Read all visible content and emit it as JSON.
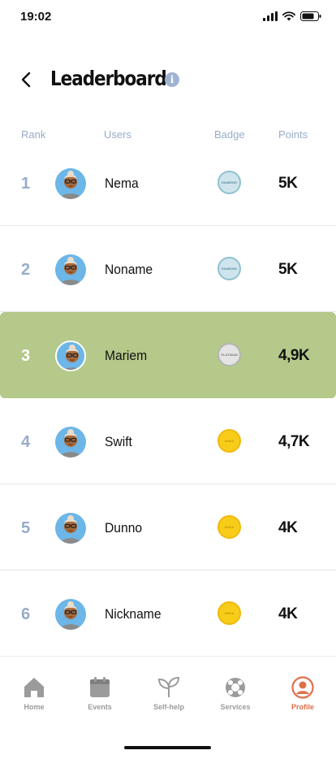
{
  "status_bar": {
    "time": "19:02"
  },
  "header": {
    "title": "Leaderboard"
  },
  "columns": {
    "rank": "Rank",
    "users": "Users",
    "badge": "Badge",
    "points": "Points"
  },
  "rows": [
    {
      "rank": "1",
      "name": "Nema",
      "badge": "diamond",
      "badge_text": "DIAMOND",
      "points": "5K",
      "highlighted": false
    },
    {
      "rank": "2",
      "name": "Noname",
      "badge": "diamond",
      "badge_text": "DIAMOND",
      "points": "5K",
      "highlighted": false
    },
    {
      "rank": "3",
      "name": "Mariem",
      "badge": "platinum",
      "badge_text": "PLATINUM",
      "points": "4,9K",
      "highlighted": true
    },
    {
      "rank": "4",
      "name": "Swift",
      "badge": "gold",
      "badge_text": "GOLD",
      "points": "4,7K",
      "highlighted": false
    },
    {
      "rank": "5",
      "name": "Dunno",
      "badge": "gold",
      "badge_text": "GOLD",
      "points": "4K",
      "highlighted": false
    },
    {
      "rank": "6",
      "name": "Nickname",
      "badge": "gold",
      "badge_text": "GOLD",
      "points": "4K",
      "highlighted": false
    }
  ],
  "nav": [
    {
      "label": "Home",
      "icon": "home-icon",
      "active": false
    },
    {
      "label": "Events",
      "icon": "calendar-icon",
      "active": false
    },
    {
      "label": "Self-help",
      "icon": "sprout-icon",
      "active": false
    },
    {
      "label": "Services",
      "icon": "lifebuoy-icon",
      "active": false
    },
    {
      "label": "Profile",
      "icon": "profile-icon",
      "active": true
    }
  ],
  "colors": {
    "highlight": "#b4c98a",
    "accent": "#e0704a",
    "muted": "#98acc8"
  }
}
